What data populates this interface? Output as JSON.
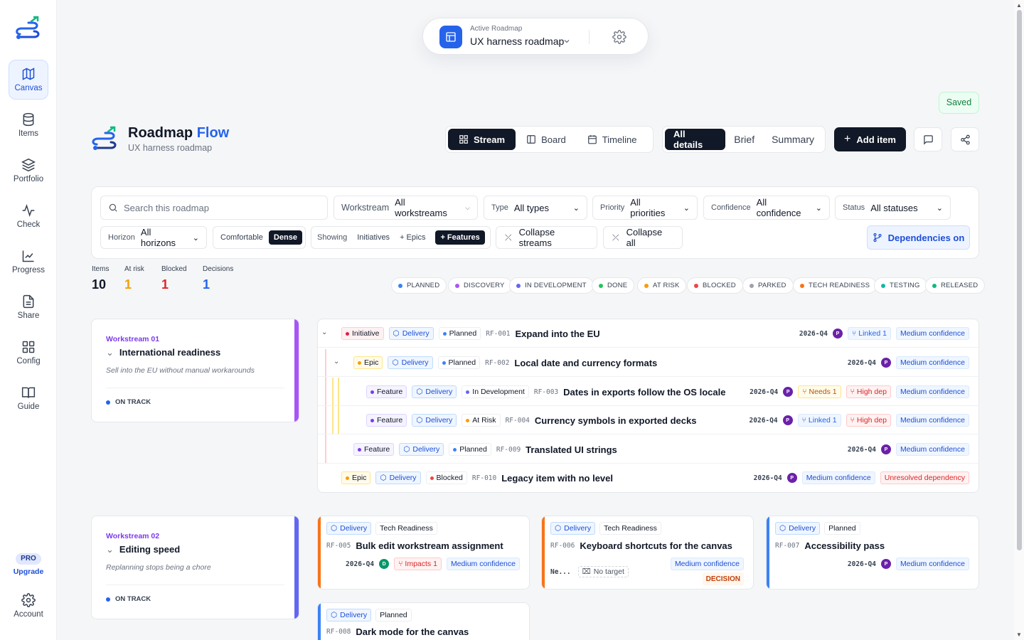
{
  "sidebar": {
    "items": [
      {
        "label": "Canvas",
        "icon": "map-icon"
      },
      {
        "label": "Items",
        "icon": "database-icon"
      },
      {
        "label": "Portfolio",
        "icon": "layers-icon"
      },
      {
        "label": "Check",
        "icon": "activity-icon"
      },
      {
        "label": "Progress",
        "icon": "chart-line-icon"
      },
      {
        "label": "Share",
        "icon": "document-icon"
      },
      {
        "label": "Config",
        "icon": "grid-icon"
      },
      {
        "label": "Guide",
        "icon": "book-icon"
      }
    ],
    "pro": "PRO",
    "upgrade": "Upgrade",
    "account": "Account"
  },
  "topbar": {
    "small_label": "Active Roadmap",
    "roadmap_name": "UX harness roadmap",
    "saved": "Saved"
  },
  "header": {
    "title_main": "Roadmap",
    "title_accent": "Flow",
    "subtitle": "UX harness roadmap",
    "views": [
      "Stream",
      "Board",
      "Timeline"
    ],
    "details": [
      "All details",
      "Brief",
      "Summary"
    ],
    "add_item": "Add item"
  },
  "filters": {
    "search_placeholder": "Search this roadmap",
    "workstream_label": "Workstream",
    "workstream_value": "All workstreams",
    "type_label": "Type",
    "type_value": "All types",
    "priority_label": "Priority",
    "priority_value": "All priorities",
    "confidence_label": "Confidence",
    "confidence_value": "All confidence",
    "status_label": "Status",
    "status_value": "All statuses",
    "horizon_label": "Horizon",
    "horizon_value": "All horizons",
    "density": [
      "Comfortable",
      "Dense"
    ],
    "showing_label": "Showing",
    "showing": [
      "Initiatives",
      "+ Epics",
      "+ Features"
    ],
    "collapse_streams": "Collapse streams",
    "collapse_all": "Collapse all",
    "dependencies": "Dependencies on"
  },
  "stats": [
    {
      "label": "Items",
      "value": "10",
      "color": "#111827"
    },
    {
      "label": "At risk",
      "value": "1",
      "color": "#f59e0b"
    },
    {
      "label": "Blocked",
      "value": "1",
      "color": "#dc2626"
    },
    {
      "label": "Decisions",
      "value": "1",
      "color": "#2563eb"
    }
  ],
  "legend": [
    {
      "label": "PLANNED",
      "color": "#3b82f6"
    },
    {
      "label": "DISCOVERY",
      "color": "#a855f7"
    },
    {
      "label": "IN DEVELOPMENT",
      "color": "#6366f1"
    },
    {
      "label": "DONE",
      "color": "#22c55e"
    },
    {
      "label": "AT RISK",
      "color": "#f59e0b"
    },
    {
      "label": "BLOCKED",
      "color": "#ef4444"
    },
    {
      "label": "PARKED",
      "color": "#9ca3af"
    },
    {
      "label": "TECH READINESS",
      "color": "#f97316"
    },
    {
      "label": "TESTING",
      "color": "#14b8a6"
    },
    {
      "label": "RELEASED",
      "color": "#10b981"
    }
  ],
  "workstreams": [
    {
      "num": "Workstream 01",
      "title": "International readiness",
      "desc": "Sell into the EU without manual workarounds",
      "status": "ON TRACK",
      "color": "#a855f7"
    },
    {
      "num": "Workstream 02",
      "title": "Editing speed",
      "desc": "Replanning stops being a chore",
      "status": "ON TRACK",
      "color": "#6366f1"
    }
  ],
  "tree_rows": [
    {
      "type": "Initiative",
      "team": "Delivery",
      "status": "Planned",
      "code": "RF-001",
      "title": "Expand into the EU",
      "quarter": "2026-Q4",
      "avatar": "P",
      "linked": "Linked 1",
      "confidence": "Medium confidence"
    },
    {
      "type": "Epic",
      "team": "Delivery",
      "status": "Planned",
      "code": "RF-002",
      "title": "Local date and currency formats",
      "quarter": "2026-Q4",
      "avatar": "P",
      "confidence": "Medium confidence"
    },
    {
      "type": "Feature",
      "team": "Delivery",
      "status": "In Development",
      "code": "RF-003",
      "title": "Dates in exports follow the OS locale",
      "quarter": "2026-Q4",
      "avatar": "P",
      "needs": "Needs 1",
      "dep": "High dep",
      "confidence": "Medium confidence"
    },
    {
      "type": "Feature",
      "team": "Delivery",
      "status": "At Risk",
      "code": "RF-004",
      "title": "Currency symbols in exported decks",
      "quarter": "2026-Q4",
      "avatar": "P",
      "linked": "Linked 1",
      "dep": "High dep",
      "confidence": "Medium confidence"
    },
    {
      "type": "Feature",
      "team": "Delivery",
      "status": "Planned",
      "code": "RF-009",
      "title": "Translated UI strings",
      "quarter": "2026-Q4",
      "avatar": "P",
      "confidence": "Medium confidence"
    },
    {
      "type": "Epic",
      "team": "Delivery",
      "status": "Blocked",
      "code": "RF-010",
      "title": "Legacy item with no level",
      "quarter": "2026-Q4",
      "avatar": "P",
      "confidence": "Medium confidence",
      "warning": "Unresolved dependency"
    }
  ],
  "cards": [
    {
      "team": "Delivery",
      "status": "Tech Readiness",
      "code": "RF-005",
      "title": "Bulk edit workstream assignment",
      "quarter": "2026-Q4",
      "avatar": "D",
      "impacts": "Impacts 1",
      "confidence": "Medium confidence"
    },
    {
      "team": "Delivery",
      "status": "Tech Readiness",
      "code": "RF-006",
      "title": "Keyboard shortcuts for the canvas",
      "short": "Ne...",
      "no_target": "No target",
      "confidence": "Medium confidence",
      "decision": "DECISION"
    },
    {
      "team": "Delivery",
      "status": "Planned",
      "code": "RF-007",
      "title": "Accessibility pass",
      "quarter": "2026-Q4",
      "avatar": "P",
      "confidence": "Medium confidence"
    },
    {
      "team": "Delivery",
      "status": "Planned",
      "code": "RF-008",
      "title": "Dark mode for the canvas"
    }
  ]
}
